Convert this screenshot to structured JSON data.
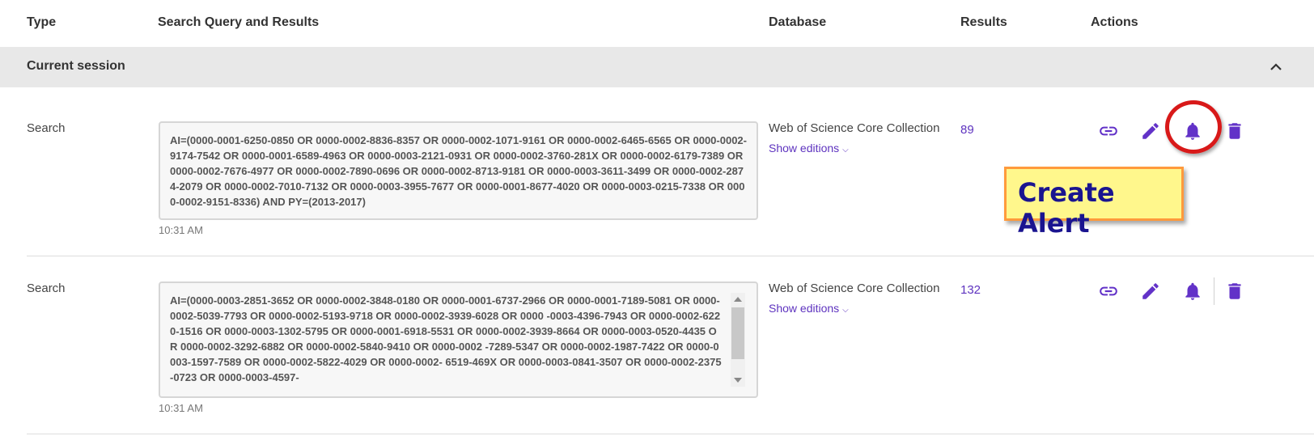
{
  "columns": {
    "type": "Type",
    "query": "Search Query and Results",
    "database": "Database",
    "results": "Results",
    "actions": "Actions"
  },
  "session": {
    "label": "Current session",
    "toggle_icon": "chevron-up-icon"
  },
  "rows": [
    {
      "type": "Search",
      "query": "AI=(0000-0001-6250-0850 OR 0000-0002-8836-8357 OR 0000-0002-1071-9161 OR 0000-0002-6465-6565 OR 0000-0002-9174-7542 OR 0000-0001-6589-4963 OR 0000-0003-2121-0931 OR 0000-0002-3760-281X OR 0000-0002-6179-7389 OR 0000-0002-7676-4977 OR 0000-0002-7890-0696 OR 0000-0002-8713-9181 OR 0000-0003-3611-3499 OR 0000-0002-2874-2079 OR 0000-0002-7010-7132 OR 0000-0003-3955-7677 OR 0000-0001-8677-4020 OR 0000-0003-0215-7338 OR 0000-0002-9151-8336) AND PY=(2013-2017)",
      "time": "10:31 AM",
      "database": "Web of Science Core Collection",
      "show_editions": "Show editions",
      "results": "89"
    },
    {
      "type": "Search",
      "query": "AI=(0000-0003-2851-3652 OR 0000-0002-3848-0180 OR 0000-0001-6737-2966 OR 0000-0001-7189-5081 OR 0000-0002-5039-7793 OR 0000-0002-5193-9718 OR 0000-0002-3939-6028 OR 0000 -0003-4396-7943 OR 0000-0002-6220-1516 OR 0000-0003-1302-5795 OR 0000-0001-6918-5531 OR 0000-0002-3939-8664 OR 0000-0003-0520-4435 OR 0000-0002-3292-6882 OR 0000-0002-5840-9410 OR 0000-0002 -7289-5347 OR 0000-0002-1987-7422 OR 0000-0003-1597-7589 OR 0000-0002-5822-4029 OR 0000-0002- 6519-469X OR 0000-0003-0841-3507 OR 0000-0002-2375-0723 OR 0000-0003-4597-",
      "time": "10:31 AM",
      "database": "Web of Science Core Collection",
      "show_editions": "Show editions",
      "results": "132"
    }
  ],
  "actions": {
    "link_icon": "link-icon",
    "edit_icon": "pencil-icon",
    "alert_icon": "bell-icon",
    "delete_icon": "trash-icon"
  },
  "annotation": {
    "callout_text": "Create Alert",
    "ring_color": "#d81919",
    "callout_bg": "#fff78c",
    "callout_border": "#ff9a3c",
    "callout_text_color": "#1a1490"
  },
  "colors": {
    "accent": "#6232c8",
    "link": "#5e33bf",
    "session_bar": "#e8e8e8"
  }
}
